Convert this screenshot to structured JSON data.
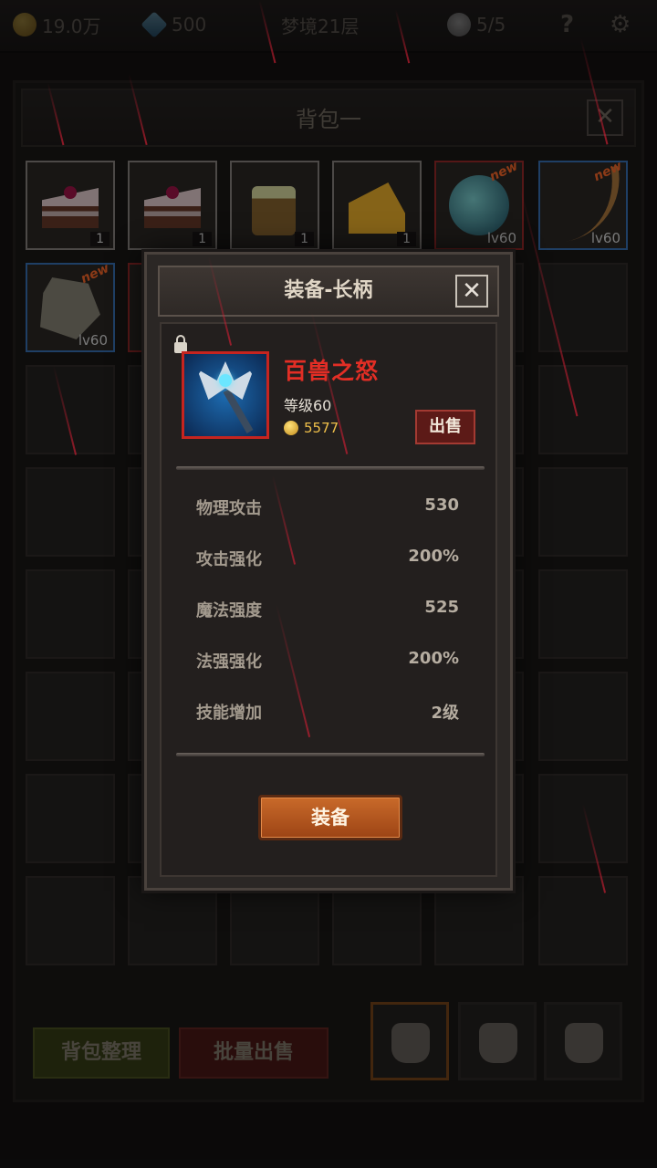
{
  "topbar": {
    "gold": "19.0万",
    "gems": "500",
    "floor": "梦境21层",
    "stamina": "5/5",
    "help": "?"
  },
  "bag": {
    "title": "背包一",
    "close": "✕",
    "items": [
      {
        "kind": "cake",
        "count": "1"
      },
      {
        "kind": "cake",
        "count": "1"
      },
      {
        "kind": "mug",
        "count": "1"
      },
      {
        "kind": "cheese",
        "count": "1"
      },
      {
        "kind": "orb",
        "level": "lv60",
        "new": "new"
      },
      {
        "kind": "bow",
        "level": "lv60",
        "new": "new"
      },
      {
        "kind": "stone",
        "level": "lv60",
        "new": "new"
      }
    ],
    "sort_label": "背包整理",
    "bulk_sell_label": "批量出售"
  },
  "modal": {
    "title": "装备-长柄",
    "close": "✕",
    "item_name": "百兽之怒",
    "item_level": "等级60",
    "price": "5577",
    "sell_label": "出售",
    "stats": [
      {
        "name": "物理攻击",
        "value": "530"
      },
      {
        "name": "攻击强化",
        "value": "200%"
      },
      {
        "name": "魔法强度",
        "value": "525"
      },
      {
        "name": "法强强化",
        "value": "200%"
      },
      {
        "name": "技能增加",
        "value": "2级"
      }
    ],
    "equip_label": "装备"
  },
  "colors": {
    "item_name": "#e22e25",
    "equip_button": "#c96a2a",
    "sell_button": "#5c1a17",
    "price": "#f0c04a"
  }
}
